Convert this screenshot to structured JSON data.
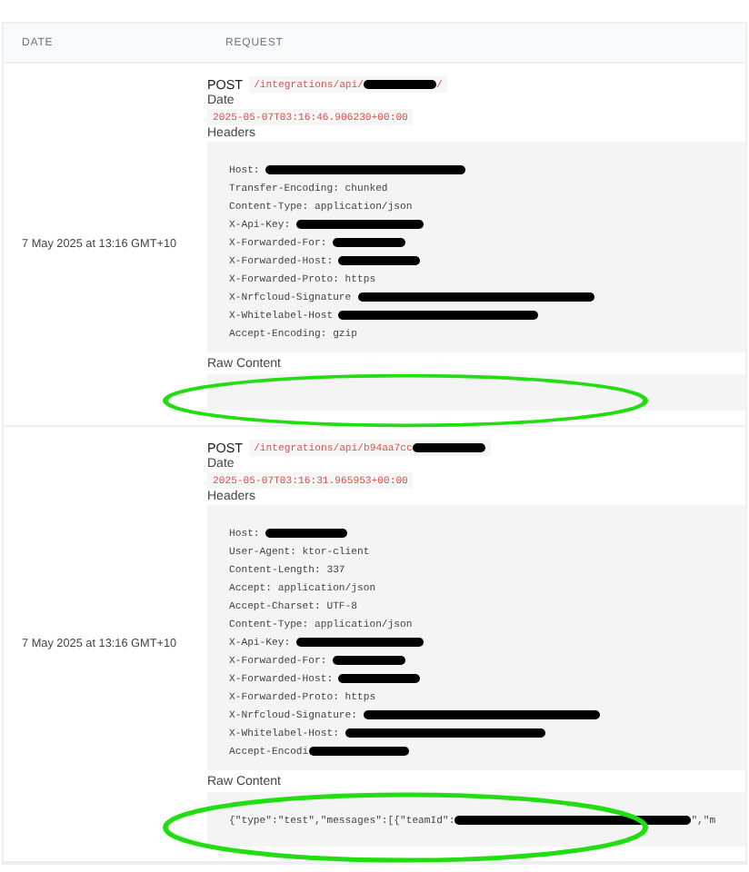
{
  "table": {
    "columns": [
      "DATE",
      "REQUEST"
    ],
    "rows": [
      {
        "date": "7 May 2025 at 13:16 GMT+10",
        "method": "POST",
        "path": [
          {
            "kind": "text",
            "text": "/integrations/api/"
          },
          {
            "kind": "redacted"
          },
          {
            "kind": "text",
            "text": "/"
          }
        ],
        "date_label": "Date",
        "timestamp": "2025-05-07T03:16:46.906230+00:00",
        "headers_label": "Headers",
        "headers": [
          [
            {
              "kind": "text",
              "text": "Host: "
            },
            {
              "kind": "redacted"
            }
          ],
          [
            {
              "kind": "text",
              "text": "Transfer-Encoding: chunked"
            }
          ],
          [
            {
              "kind": "text",
              "text": "Content-Type: application/json"
            }
          ],
          [
            {
              "kind": "text",
              "text": "X-Api-Key: "
            },
            {
              "kind": "redacted"
            }
          ],
          [
            {
              "kind": "text",
              "text": "X-Forwarded-For: "
            },
            {
              "kind": "redacted"
            }
          ],
          [
            {
              "kind": "text",
              "text": "X-Forwarded-Host: "
            },
            {
              "kind": "redacted"
            }
          ],
          [
            {
              "kind": "text",
              "text": "X-Forwarded-Proto: https"
            }
          ],
          [
            {
              "kind": "text",
              "text": "X-Nrfcloud-Signature "
            },
            {
              "kind": "redacted"
            }
          ],
          [
            {
              "kind": "text",
              "text": "X-Whitelabel-Host "
            },
            {
              "kind": "redacted"
            }
          ],
          [
            {
              "kind": "text",
              "text": "Accept-Encoding: gzip"
            }
          ]
        ],
        "raw_label": "Raw Content",
        "raw": [],
        "circled": true
      },
      {
        "date": "7 May 2025 at 13:16 GMT+10",
        "method": "POST",
        "path": [
          {
            "kind": "text",
            "text": "/integrations/api/b94aa7cc"
          },
          {
            "kind": "redacted"
          }
        ],
        "date_label": "Date",
        "timestamp": "2025-05-07T03:16:31.965953+00:00",
        "headers_label": "Headers",
        "headers": [
          [
            {
              "kind": "text",
              "text": "Host: "
            },
            {
              "kind": "redacted"
            }
          ],
          [
            {
              "kind": "text",
              "text": "User-Agent: ktor-client"
            }
          ],
          [
            {
              "kind": "text",
              "text": "Content-Length: 337"
            }
          ],
          [
            {
              "kind": "text",
              "text": "Accept: application/json"
            }
          ],
          [
            {
              "kind": "text",
              "text": "Accept-Charset: UTF-8"
            }
          ],
          [
            {
              "kind": "text",
              "text": "Content-Type: application/json"
            }
          ],
          [
            {
              "kind": "text",
              "text": "X-Api-Key: "
            },
            {
              "kind": "redacted"
            }
          ],
          [
            {
              "kind": "text",
              "text": "X-Forwarded-For: "
            },
            {
              "kind": "redacted"
            }
          ],
          [
            {
              "kind": "text",
              "text": "X-Forwarded-Host: "
            },
            {
              "kind": "redacted"
            }
          ],
          [
            {
              "kind": "text",
              "text": "X-Forwarded-Proto: https"
            }
          ],
          [
            {
              "kind": "text",
              "text": "X-Nrfcloud-Signature: "
            },
            {
              "kind": "redacted"
            }
          ],
          [
            {
              "kind": "text",
              "text": "X-Whitelabel-Host: "
            },
            {
              "kind": "redacted"
            }
          ],
          [
            {
              "kind": "text",
              "text": "Accept-Encodi"
            },
            {
              "kind": "redacted"
            }
          ]
        ],
        "raw_label": "Raw Content",
        "raw": [
          {
            "kind": "text",
            "text": "{\"type\":\"test\",\"messages\":[{\"teamId\":"
          },
          {
            "kind": "redacted"
          },
          {
            "kind": "text",
            "text": "\",\"m"
          }
        ],
        "circled": true
      }
    ]
  }
}
